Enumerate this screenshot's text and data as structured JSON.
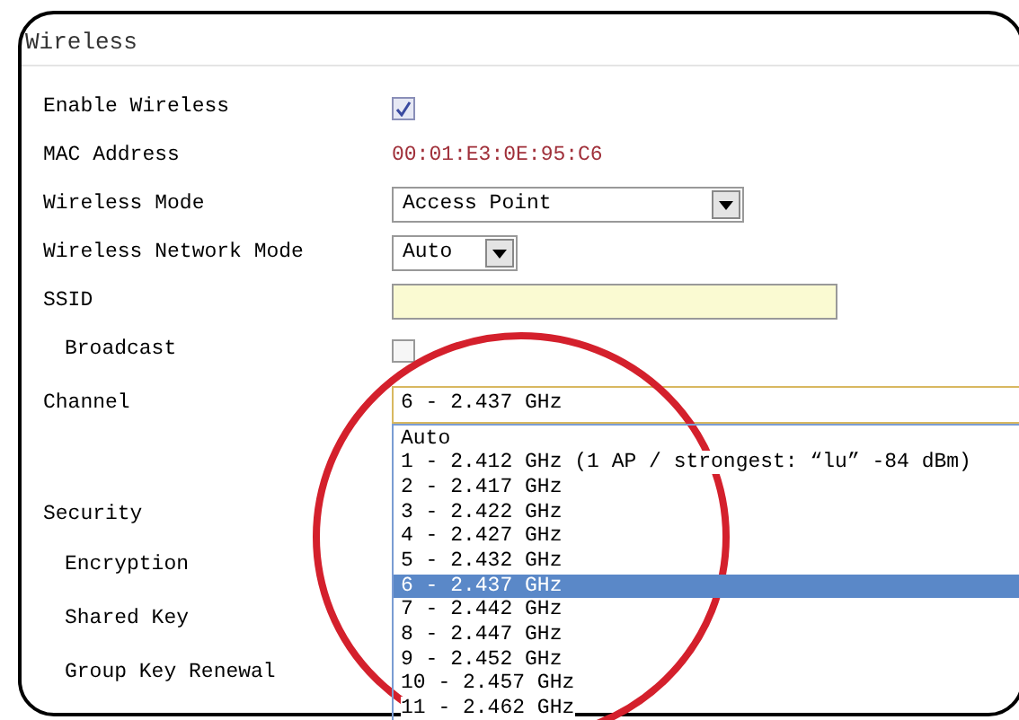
{
  "panel": {
    "title": "Wireless"
  },
  "rows": [
    {
      "label": "Enable Wireless",
      "kind": "checkbox",
      "checked": true
    },
    {
      "label": "MAC Address",
      "kind": "text",
      "value": "00:01:E3:0E:95:C6"
    },
    {
      "label": "Wireless Mode",
      "kind": "select",
      "value": "Access Point"
    },
    {
      "label": "Wireless Network Mode",
      "kind": "select",
      "value": "Auto"
    },
    {
      "label": "SSID",
      "kind": "input",
      "value": "",
      "children": [
        {
          "label": "Broadcast",
          "kind": "checkbox",
          "checked": false
        }
      ]
    },
    {
      "label": "Channel",
      "kind": "channel",
      "value": "6 - 2.437 GHz",
      "expanded": true,
      "options": [
        {
          "label": "Auto",
          "selected": false
        },
        {
          "label": "1 - 2.412 GHz (1 AP / strongest: “lu” -84 dBm)",
          "selected": false
        },
        {
          "label": "2 - 2.417 GHz",
          "selected": false
        },
        {
          "label": "3 - 2.422 GHz",
          "selected": false
        },
        {
          "label": "4 - 2.427 GHz",
          "selected": false
        },
        {
          "label": "5 - 2.432 GHz",
          "selected": false
        },
        {
          "label": "6 - 2.437 GHz",
          "selected": true
        },
        {
          "label": "7 - 2.442 GHz",
          "selected": false
        },
        {
          "label": "8 - 2.447 GHz",
          "selected": false
        },
        {
          "label": "9 - 2.452 GHz",
          "selected": false
        },
        {
          "label": "10 - 2.457 GHz",
          "selected": false
        },
        {
          "label": "11 - 2.462 GHz",
          "selected": false
        }
      ]
    },
    {
      "label": "Security",
      "kind": "heading",
      "children": [
        {
          "label": "Encryption",
          "kind": "heading"
        },
        {
          "label": "Shared Key",
          "kind": "heading"
        },
        {
          "label": "Group Key Renewal",
          "kind": "heading"
        }
      ]
    }
  ]
}
